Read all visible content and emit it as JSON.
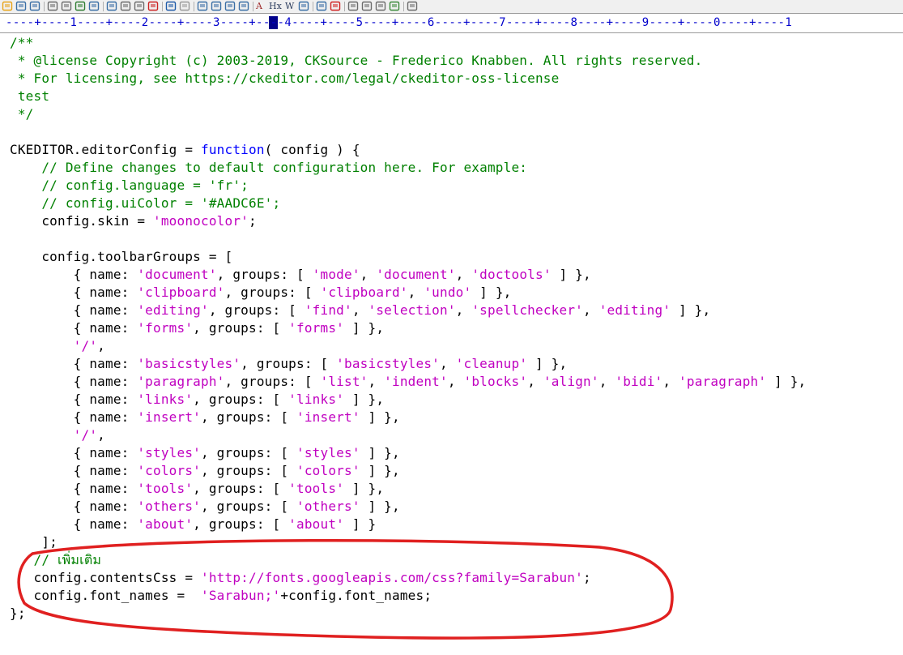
{
  "colors": {
    "comment": "#008000",
    "string": "#c000c0",
    "keyword": "#0000ff",
    "text": "#000000",
    "ruler": "#0000cc",
    "highlight": "#e02020"
  },
  "toolbar": {
    "icons": [
      "open-folder-icon",
      "save-icon",
      "save-all-icon",
      "print-preview-icon",
      "print-icon",
      "spell-check-icon",
      "format-icon",
      "cut-icon",
      "copy-icon",
      "paste-icon",
      "delete-icon",
      "undo-icon",
      "redo-icon",
      "find-icon",
      "find-replace-icon",
      "find-in-files-icon",
      "go-to-icon",
      "font-icon",
      "heading-icon",
      "word-wrap-icon",
      "align-icon",
      "spelling-icon",
      "check-mark-icon",
      "document-icon",
      "window-icon",
      "preview-icon",
      "screenshot-icon",
      "help-icon"
    ],
    "font_label": "A",
    "heading_label": "Hx",
    "wrap_label": "W"
  },
  "ruler": {
    "text": "----+----1----+----2----+----3----+----4----+----5----+----6----+----7----+----8----+----9----+----0----+----1"
  },
  "code_lines": [
    [
      [
        "c",
        "/**"
      ]
    ],
    [
      [
        "c",
        " * @license Copyright (c) 2003-2019, CKSource - Frederico Knabben. All rights reserved."
      ]
    ],
    [
      [
        "c",
        " * For licensing, see https://ckeditor.com/legal/ckeditor-oss-license"
      ]
    ],
    [
      [
        "c",
        " test"
      ]
    ],
    [
      [
        "c",
        " */"
      ]
    ],
    [],
    [
      [
        "t",
        "CKEDITOR.editorConfig = "
      ],
      [
        "k",
        "function"
      ],
      [
        "t",
        "( config ) {"
      ]
    ],
    [
      [
        "c",
        "    // Define changes to default configuration here. For example:"
      ]
    ],
    [
      [
        "c",
        "    // config.language = 'fr';"
      ]
    ],
    [
      [
        "c",
        "    // config.uiColor = '#AADC6E';"
      ]
    ],
    [
      [
        "t",
        "    config.skin = "
      ],
      [
        "s",
        "'moonocolor'"
      ],
      [
        "t",
        ";"
      ]
    ],
    [],
    [
      [
        "t",
        "    config.toolbarGroups = ["
      ]
    ],
    [
      [
        "t",
        "        { name: "
      ],
      [
        "s",
        "'document'"
      ],
      [
        "t",
        ", groups: [ "
      ],
      [
        "s",
        "'mode'"
      ],
      [
        "t",
        ", "
      ],
      [
        "s",
        "'document'"
      ],
      [
        "t",
        ", "
      ],
      [
        "s",
        "'doctools'"
      ],
      [
        "t",
        " ] },"
      ]
    ],
    [
      [
        "t",
        "        { name: "
      ],
      [
        "s",
        "'clipboard'"
      ],
      [
        "t",
        ", groups: [ "
      ],
      [
        "s",
        "'clipboard'"
      ],
      [
        "t",
        ", "
      ],
      [
        "s",
        "'undo'"
      ],
      [
        "t",
        " ] },"
      ]
    ],
    [
      [
        "t",
        "        { name: "
      ],
      [
        "s",
        "'editing'"
      ],
      [
        "t",
        ", groups: [ "
      ],
      [
        "s",
        "'find'"
      ],
      [
        "t",
        ", "
      ],
      [
        "s",
        "'selection'"
      ],
      [
        "t",
        ", "
      ],
      [
        "s",
        "'spellchecker'"
      ],
      [
        "t",
        ", "
      ],
      [
        "s",
        "'editing'"
      ],
      [
        "t",
        " ] },"
      ]
    ],
    [
      [
        "t",
        "        { name: "
      ],
      [
        "s",
        "'forms'"
      ],
      [
        "t",
        ", groups: [ "
      ],
      [
        "s",
        "'forms'"
      ],
      [
        "t",
        " ] },"
      ]
    ],
    [
      [
        "t",
        "        "
      ],
      [
        "s",
        "'/'"
      ],
      [
        "t",
        ","
      ]
    ],
    [
      [
        "t",
        "        { name: "
      ],
      [
        "s",
        "'basicstyles'"
      ],
      [
        "t",
        ", groups: [ "
      ],
      [
        "s",
        "'basicstyles'"
      ],
      [
        "t",
        ", "
      ],
      [
        "s",
        "'cleanup'"
      ],
      [
        "t",
        " ] },"
      ]
    ],
    [
      [
        "t",
        "        { name: "
      ],
      [
        "s",
        "'paragraph'"
      ],
      [
        "t",
        ", groups: [ "
      ],
      [
        "s",
        "'list'"
      ],
      [
        "t",
        ", "
      ],
      [
        "s",
        "'indent'"
      ],
      [
        "t",
        ", "
      ],
      [
        "s",
        "'blocks'"
      ],
      [
        "t",
        ", "
      ],
      [
        "s",
        "'align'"
      ],
      [
        "t",
        ", "
      ],
      [
        "s",
        "'bidi'"
      ],
      [
        "t",
        ", "
      ],
      [
        "s",
        "'paragraph'"
      ],
      [
        "t",
        " ] },"
      ]
    ],
    [
      [
        "t",
        "        { name: "
      ],
      [
        "s",
        "'links'"
      ],
      [
        "t",
        ", groups: [ "
      ],
      [
        "s",
        "'links'"
      ],
      [
        "t",
        " ] },"
      ]
    ],
    [
      [
        "t",
        "        { name: "
      ],
      [
        "s",
        "'insert'"
      ],
      [
        "t",
        ", groups: [ "
      ],
      [
        "s",
        "'insert'"
      ],
      [
        "t",
        " ] },"
      ]
    ],
    [
      [
        "t",
        "        "
      ],
      [
        "s",
        "'/'"
      ],
      [
        "t",
        ","
      ]
    ],
    [
      [
        "t",
        "        { name: "
      ],
      [
        "s",
        "'styles'"
      ],
      [
        "t",
        ", groups: [ "
      ],
      [
        "s",
        "'styles'"
      ],
      [
        "t",
        " ] },"
      ]
    ],
    [
      [
        "t",
        "        { name: "
      ],
      [
        "s",
        "'colors'"
      ],
      [
        "t",
        ", groups: [ "
      ],
      [
        "s",
        "'colors'"
      ],
      [
        "t",
        " ] },"
      ]
    ],
    [
      [
        "t",
        "        { name: "
      ],
      [
        "s",
        "'tools'"
      ],
      [
        "t",
        ", groups: [ "
      ],
      [
        "s",
        "'tools'"
      ],
      [
        "t",
        " ] },"
      ]
    ],
    [
      [
        "t",
        "        { name: "
      ],
      [
        "s",
        "'others'"
      ],
      [
        "t",
        ", groups: [ "
      ],
      [
        "s",
        "'others'"
      ],
      [
        "t",
        " ] },"
      ]
    ],
    [
      [
        "t",
        "        { name: "
      ],
      [
        "s",
        "'about'"
      ],
      [
        "t",
        ", groups: [ "
      ],
      [
        "s",
        "'about'"
      ],
      [
        "t",
        " ] }"
      ]
    ],
    [
      [
        "t",
        "    ];"
      ]
    ],
    [
      [
        "c",
        "   // เพิ่มเติม"
      ]
    ],
    [
      [
        "t",
        "   config.contentsCss = "
      ],
      [
        "s",
        "'http://fonts.googleapis.com/css?family=Sarabun'"
      ],
      [
        "t",
        ";"
      ]
    ],
    [
      [
        "t",
        "   config.font_names =  "
      ],
      [
        "s",
        "'Sarabun;'"
      ],
      [
        "t",
        "+config.font_names;"
      ]
    ],
    [
      [
        "t",
        "};"
      ]
    ]
  ]
}
